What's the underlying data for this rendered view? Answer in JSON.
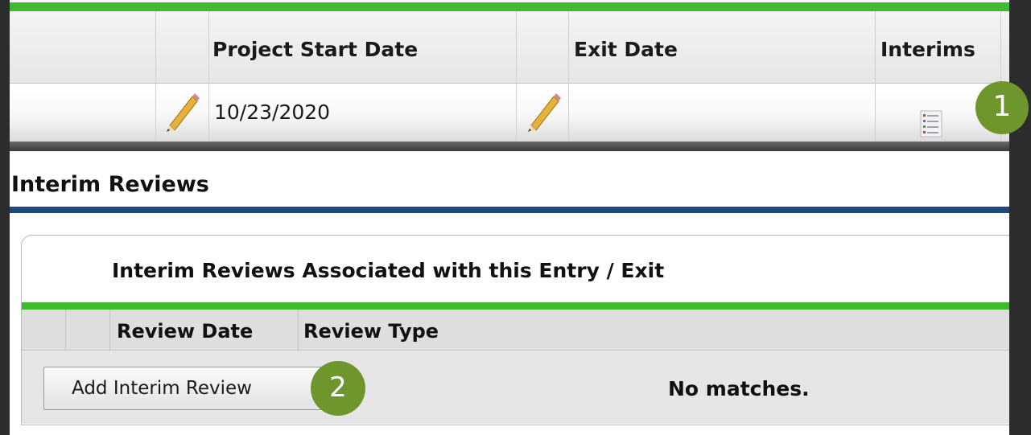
{
  "table": {
    "headers": {
      "start_date": "Project Start Date",
      "exit_date": "Exit Date",
      "interims": "Interims"
    },
    "row": {
      "start_date": "10/23/2020",
      "exit_date": ""
    }
  },
  "interim_reviews": {
    "title": "Interim Reviews",
    "subtitle": "Interim Reviews Associated with this Entry / Exit",
    "columns": [
      "Review Date",
      "Review Type"
    ],
    "add_button": "Add Interim Review",
    "empty_text": "No matches."
  },
  "badges": [
    "1",
    "2"
  ],
  "colors": {
    "green_rule": "#3dbb2f",
    "blue_rule": "#1f4a7d",
    "badge": "#6f962d",
    "frame": "#2c2c2c"
  },
  "icons": [
    "pencil-icon",
    "interims-document-icon"
  ]
}
